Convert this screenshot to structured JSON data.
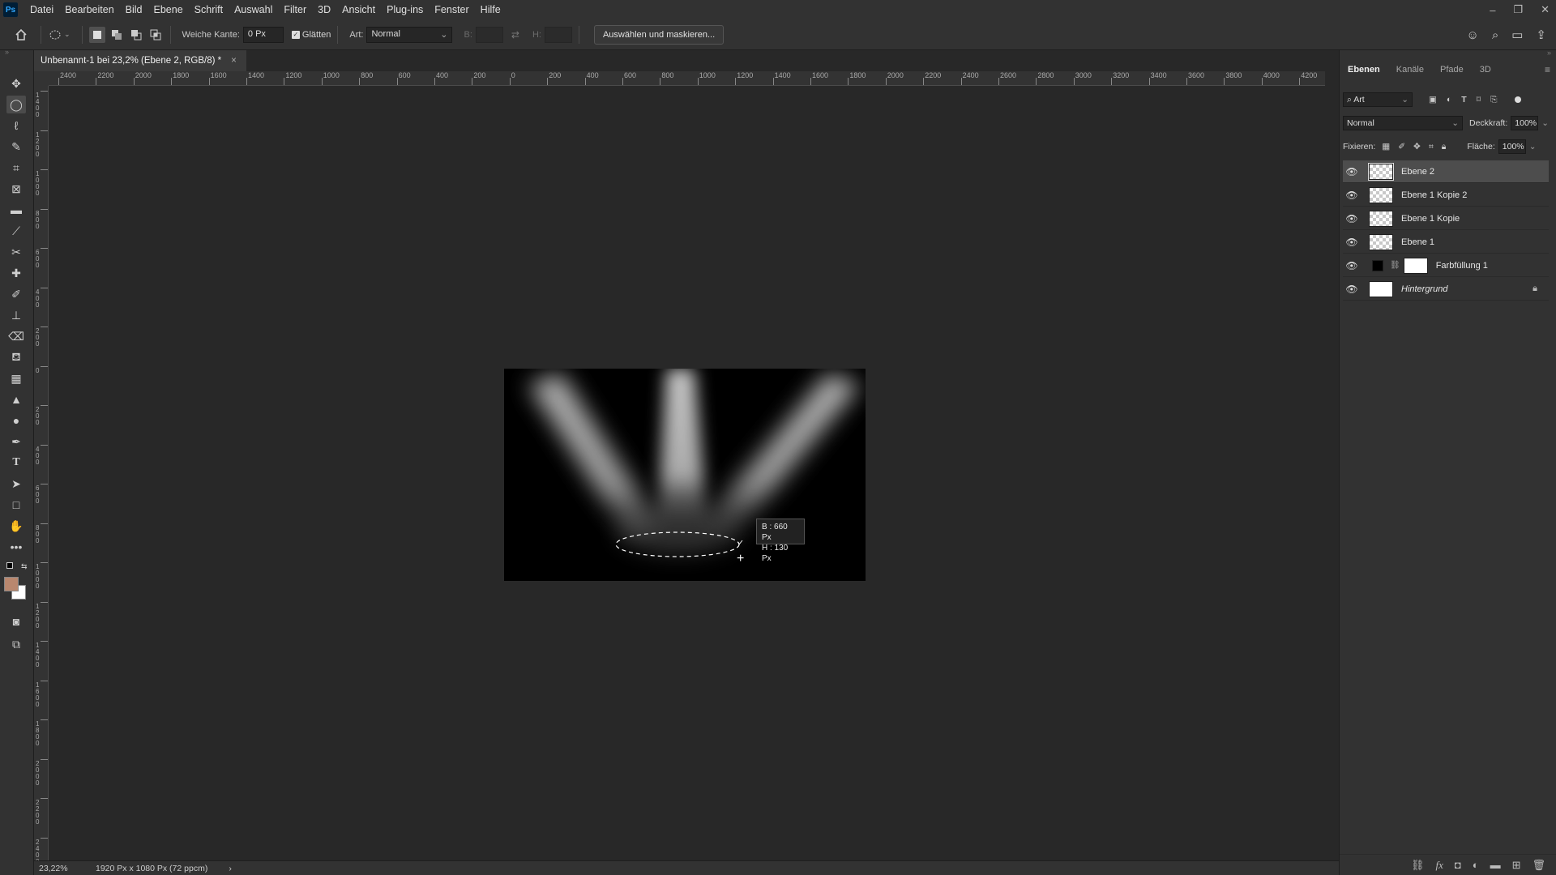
{
  "menu": {
    "logo": "Ps",
    "items": [
      "Datei",
      "Bearbeiten",
      "Bild",
      "Ebene",
      "Schrift",
      "Auswahl",
      "Filter",
      "3D",
      "Ansicht",
      "Plug-ins",
      "Fenster",
      "Hilfe"
    ]
  },
  "window_controls": {
    "minimize": "–",
    "restore": "❐",
    "close": "✕"
  },
  "options": {
    "feather_label": "Weiche Kante:",
    "feather_value": "0 Px",
    "antialias_label": "Glätten",
    "antialias_checked": true,
    "style_label": "Art:",
    "style_value": "Normal",
    "width_label": "B:",
    "height_label": "H:",
    "select_mask_label": "Auswählen und maskieren..."
  },
  "document": {
    "tab_title": "Unbenannt-1 bei 23,2% (Ebene 2, RGB/8) *",
    "close_glyph": "×"
  },
  "ruler": {
    "top_labels": [
      "2400",
      "2200",
      "2000",
      "1800",
      "1600",
      "1400",
      "1200",
      "1000",
      "800",
      "600",
      "400",
      "200",
      "0",
      "200",
      "400",
      "600",
      "800",
      "1000",
      "1200",
      "1400",
      "1600",
      "1800",
      "2000",
      "2200",
      "2400",
      "2600",
      "2800",
      "3000",
      "3200",
      "3400",
      "3600",
      "3800",
      "4000",
      "4200"
    ],
    "left_labels": [
      "1400",
      "1200",
      "1000",
      "800",
      "600",
      "400",
      "200",
      "0",
      "200",
      "400",
      "600",
      "800",
      "1000",
      "1200",
      "1400",
      "1600",
      "1800",
      "2000",
      "2200",
      "2400"
    ]
  },
  "selection_tooltip": {
    "width": "B :  660 Px",
    "height": "H :  130 Px"
  },
  "status": {
    "zoom": "23,22%",
    "doc_info": "1920 Px x 1080 Px (72 ppcm)",
    "arrow": "›"
  },
  "panel": {
    "tabs": [
      "Ebenen",
      "Kanäle",
      "Pfade",
      "3D"
    ],
    "filter_label": "Art",
    "blend_mode": "Normal",
    "opacity_label": "Deckkraft:",
    "opacity_value": "100%",
    "lock_label": "Fixieren:",
    "fill_label": "Fläche:",
    "fill_value": "100%",
    "layers": [
      {
        "name": "Ebene 2",
        "selected": true,
        "type": "transparent"
      },
      {
        "name": "Ebene 1 Kopie 2",
        "selected": false,
        "type": "transparent"
      },
      {
        "name": "Ebene 1 Kopie",
        "selected": false,
        "type": "transparent"
      },
      {
        "name": "Ebene 1",
        "selected": false,
        "type": "transparent"
      },
      {
        "name": "Farbfüllung 1",
        "selected": false,
        "type": "fill"
      },
      {
        "name": "Hintergrund",
        "selected": false,
        "type": "background",
        "locked": true
      }
    ]
  },
  "colors": {
    "accent": "#31a8ff",
    "ui_bg": "#323232",
    "canvas_bg": "#282828",
    "foreground_swatch": "#b9876e",
    "background_swatch": "#ffffff"
  }
}
